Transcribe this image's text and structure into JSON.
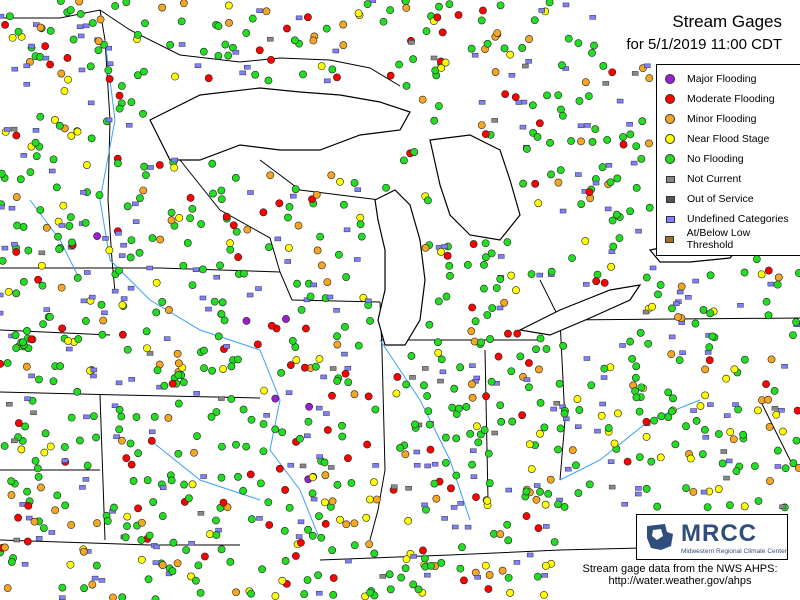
{
  "header": {
    "title": "Stream Gages",
    "subtitle": "for 5/1/2019 11:00 CDT"
  },
  "legend": {
    "items": [
      {
        "label": "Major Flooding",
        "color": "#9b1fd0",
        "shape": "circle"
      },
      {
        "label": "Moderate Flooding",
        "color": "#ff0000",
        "shape": "circle"
      },
      {
        "label": "Minor Flooding",
        "color": "#f5a623",
        "shape": "circle"
      },
      {
        "label": "Near Flood Stage",
        "color": "#ffff00",
        "shape": "circle"
      },
      {
        "label": "No Flooding",
        "color": "#22dd22",
        "shape": "circle"
      },
      {
        "label": "Not Current",
        "color": "#888888",
        "shape": "square"
      },
      {
        "label": "Out of Service",
        "color": "#555555",
        "shape": "square"
      },
      {
        "label": "Undefined Categories",
        "color": "#7f7fff",
        "shape": "square"
      },
      {
        "label": "At/Below Low Threshold",
        "color": "#a0702a",
        "shape": "square"
      }
    ]
  },
  "logo": {
    "name": "MRCC",
    "subtitle": "Midwestern Regional Climate Center"
  },
  "credit": {
    "line1": "Stream gage data from the NWS AHPS:",
    "line2": "http://water.weather.gov/ahps"
  },
  "colors": {
    "water": "#ffffff",
    "border": "#000000",
    "river": "#3aa0ff"
  },
  "icons": {
    "logo": "mrcc-logo-icon"
  }
}
